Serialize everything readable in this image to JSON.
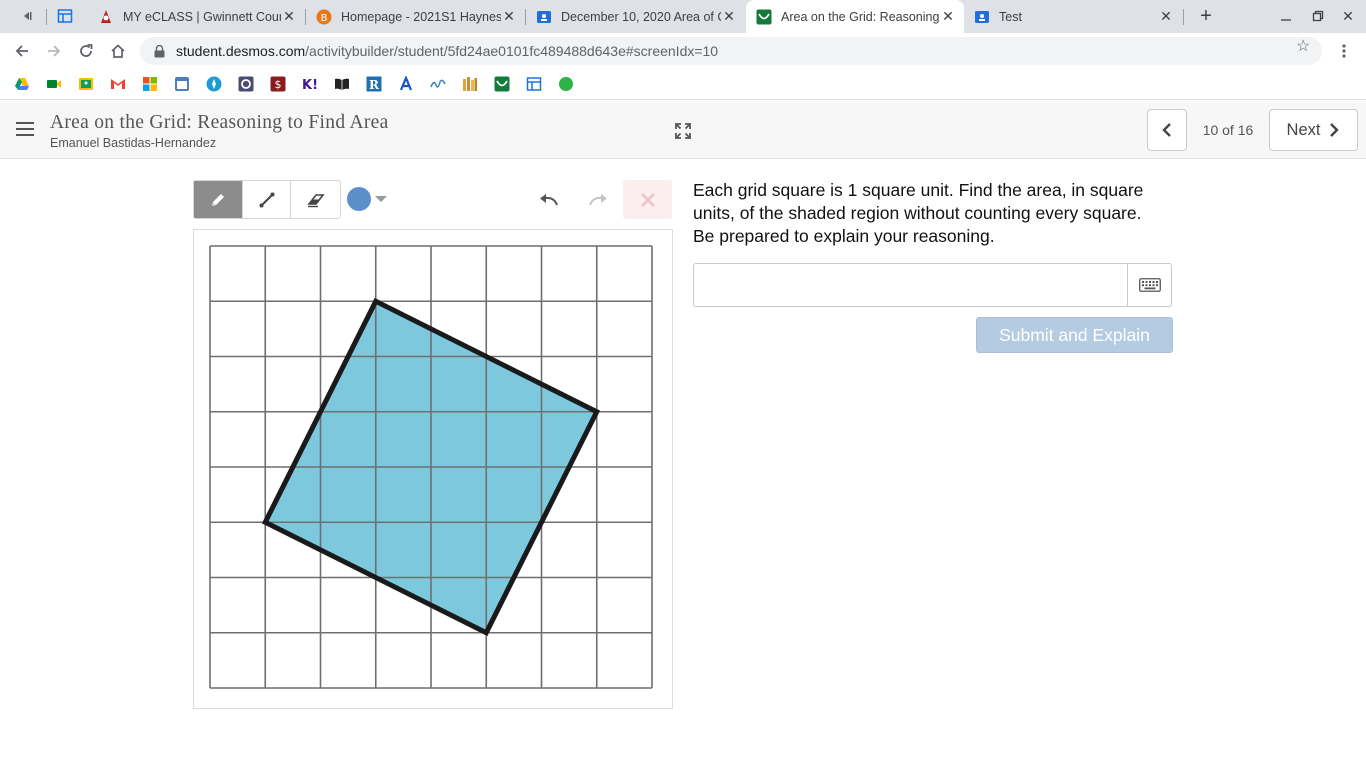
{
  "browser": {
    "tabs": [
      {
        "title": "MY eCLASS | Gwinnett Count",
        "favicon": "eclass-icon"
      },
      {
        "title": "Homepage - 2021S1 Haynes",
        "favicon": "brightspace-icon"
      },
      {
        "title": "December 10, 2020 Area of C",
        "favicon": "classroom-icon"
      },
      {
        "title": "Area on the Grid: Reasoning t",
        "favicon": "desmos-icon",
        "active": true
      },
      {
        "title": "Test",
        "favicon": "classroom-icon"
      }
    ],
    "url": {
      "host": "student.desmos.com",
      "path": "/activitybuilder/student/5fd24ae0101fc489488d643e#screenIdx=10"
    },
    "colors": {
      "tabstrip": "#dee1e6",
      "omnibox": "#f1f3f4"
    }
  },
  "header": {
    "title": "Area on the Grid: Reasoning to Find Area",
    "student": "Emanuel Bastidas-Hernandez",
    "page_indicator": "10 of 16",
    "next_label": "Next"
  },
  "sketch": {
    "tools": [
      "pencil-icon",
      "line-icon",
      "eraser-icon"
    ],
    "selected_tool": "pencil",
    "pen_color": "#5b8fc9",
    "shaded_fill": "#7ec8dd",
    "grid_size": 8,
    "shape_vertices": [
      [
        3,
        1
      ],
      [
        7,
        3
      ],
      [
        5,
        7
      ],
      [
        1,
        5
      ]
    ]
  },
  "question": {
    "prompt": "Each grid square is 1 square unit. Find the area, in square units, of the shaded region without counting every square. Be prepared to explain your reasoning.",
    "answer_value": "",
    "submit_label": "Submit and Explain",
    "submit_color": "#b4cbe1"
  }
}
